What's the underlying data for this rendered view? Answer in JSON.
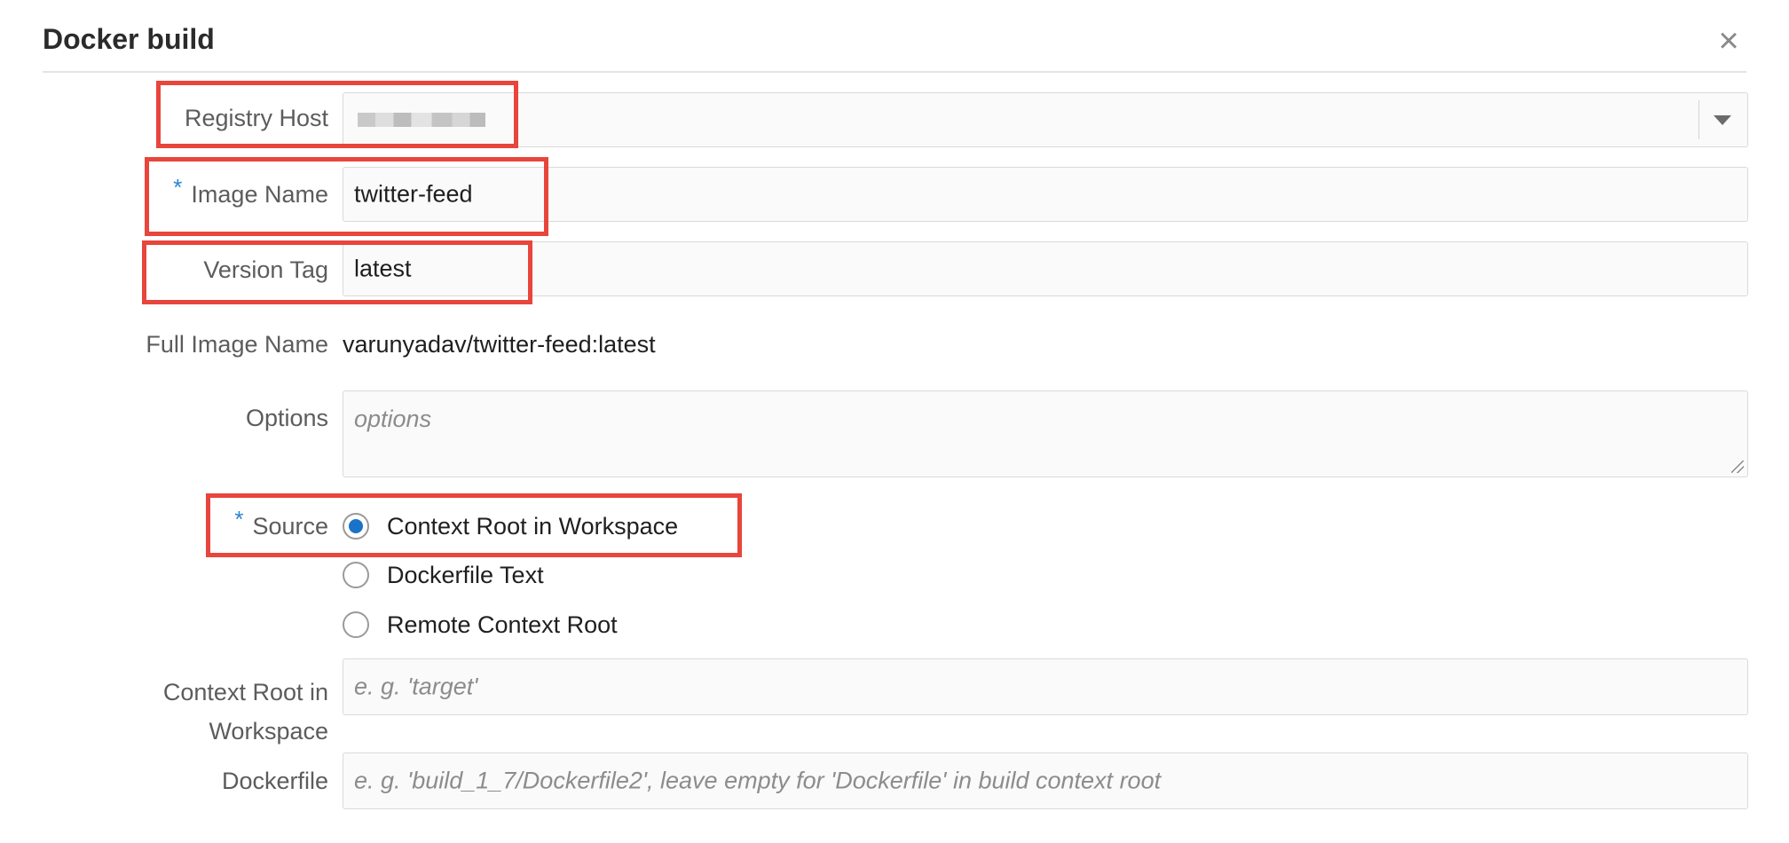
{
  "dialog": {
    "title": "Docker build",
    "close_glyph": "×"
  },
  "form": {
    "registry_host": {
      "label": "Registry Host",
      "value_obscured": true
    },
    "image_name": {
      "label": "Image Name",
      "required": "*",
      "value": "twitter-feed"
    },
    "version_tag": {
      "label": "Version Tag",
      "value": "latest"
    },
    "full_image_name": {
      "label": "Full Image Name",
      "value": "varunyadav/twitter-feed:latest"
    },
    "options": {
      "label": "Options",
      "placeholder": "options"
    },
    "source": {
      "label": "Source",
      "required": "*",
      "options": [
        {
          "label": "Context Root in Workspace",
          "checked": true
        },
        {
          "label": "Dockerfile Text",
          "checked": false
        },
        {
          "label": "Remote Context Root",
          "checked": false
        }
      ]
    },
    "context_root": {
      "label_line1": "Context Root in",
      "label_line2": "Workspace",
      "placeholder": "e. g. 'target'"
    },
    "dockerfile": {
      "label": "Dockerfile",
      "placeholder": "e. g.  'build_1_7/Dockerfile2', leave empty for 'Dockerfile' in build context root"
    }
  },
  "colors": {
    "highlight": "#e8453c",
    "required_marker": "#2a84d6",
    "radio_selected": "#1a73c9"
  },
  "icons": {
    "close": "close-icon",
    "dropdown": "chevron-down-icon"
  }
}
